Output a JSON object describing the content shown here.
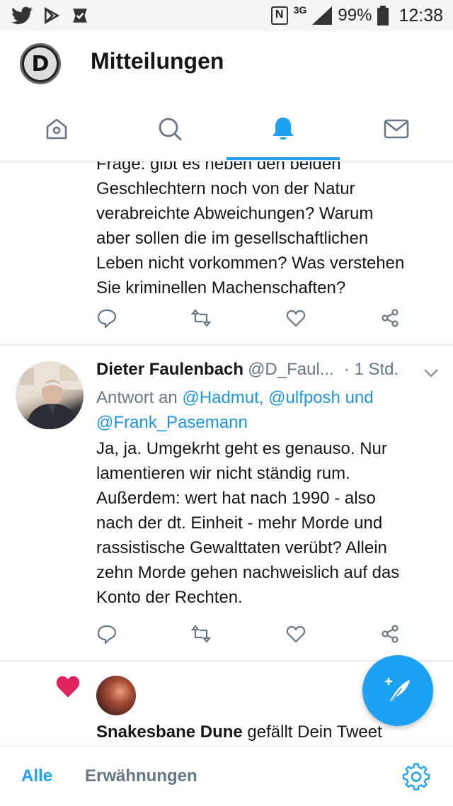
{
  "status_bar": {
    "network": "3G",
    "battery": "99%",
    "time": "12:38"
  },
  "header": {
    "logo_letter": "D",
    "title": "Mitteilungen"
  },
  "tabs": [
    {
      "icon": "home-icon",
      "active": false
    },
    {
      "icon": "search-icon",
      "active": false
    },
    {
      "icon": "bell-icon",
      "active": true
    },
    {
      "icon": "mail-icon",
      "active": false
    }
  ],
  "colors": {
    "accent": "#1da1f2",
    "muted": "#657786",
    "mention": "#1b95e0",
    "like": "#e0245e"
  },
  "tweet1": {
    "lines": [
      "Frage: gibt es neben den beiden",
      "Geschlechtern noch von der Natur",
      "verabreichte Abweichungen? Warum",
      "aber sollen die im gesellschaftlichen",
      "Leben nicht vorkommen? Was verstehen",
      "Sie kriminellen Machenschaften?"
    ]
  },
  "tweet2": {
    "author_name": "Dieter Faulenbach",
    "author_handle": "@D_Faul...",
    "time": "· 1 Std.",
    "reply_prefix": "Antwort an ",
    "reply_mentions_1": "@Hadmut, @ulfposh und",
    "reply_mentions_2": "@Frank_Pasemann",
    "lines": [
      "Ja, ja. Umgekrht geht es genauso. Nur",
      "lamentieren wir nicht ständig rum.",
      "Außerdem: wert hat nach 1990 - also",
      "nach der dt. Einheit - mehr Morde und",
      "rassistische Gewalttaten verübt? Allein",
      "zehn Morde gehen nachweislich auf das",
      "Konto der Rechten."
    ]
  },
  "like_notification": {
    "user": "Snakesbane Dune",
    "text": " gefällt Dein Tweet"
  },
  "bottom_bar": {
    "all_label": "Alle",
    "mentions_label": "Erwähnungen"
  }
}
